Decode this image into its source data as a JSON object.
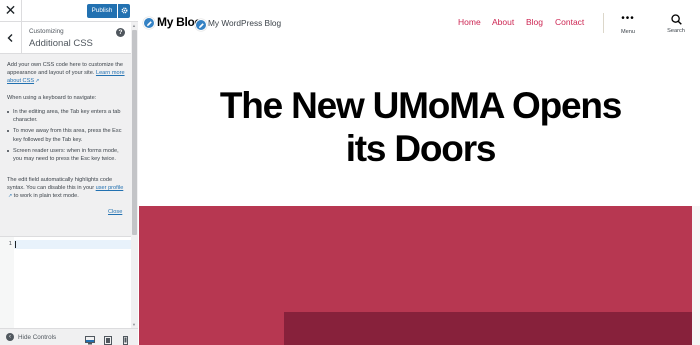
{
  "customizer": {
    "close_icon": "close-icon",
    "publish_label": "Publish",
    "publish_settings_icon": "gear-icon",
    "customizing_label": "Customizing",
    "section_title": "Additional CSS",
    "help_icon": "question-icon",
    "description_1": "Add your own CSS code here to customize the appearance and layout of your site.",
    "learn_more_link": "Learn more about CSS",
    "description_2": "When using a keyboard to navigate:",
    "bullets": [
      "In the editing area, the Tab key enters a tab character.",
      "To move away from this area, press the Esc key followed by the Tab key.",
      "Screen reader users: when in forms mode, you may need to press the Esc key twice."
    ],
    "description_3_prefix": "The edit field automatically highlights code syntax. You can disable this in your",
    "user_profile_link": "user profile",
    "description_3_suffix": "to work in plain text mode.",
    "close_link": "Close",
    "editor": {
      "line_number": "1",
      "content": ""
    },
    "footer": {
      "hide_controls_label": "Hide Controls",
      "devices": [
        "desktop",
        "tablet",
        "mobile"
      ],
      "active_device": "desktop"
    }
  },
  "site": {
    "title": "My Blog",
    "tagline": "My WordPress Blog",
    "nav": [
      "Home",
      "About",
      "Blog",
      "Contact"
    ],
    "menu_label": "Menu",
    "search_label": "Search",
    "post_title_line_1": "The New UMoMA Opens",
    "post_title_line_2": "its Doors"
  },
  "colors": {
    "admin_blue": "#2271b1",
    "accent": "#cd2653",
    "cover": "#b73751",
    "cover_dark": "#87213b"
  }
}
